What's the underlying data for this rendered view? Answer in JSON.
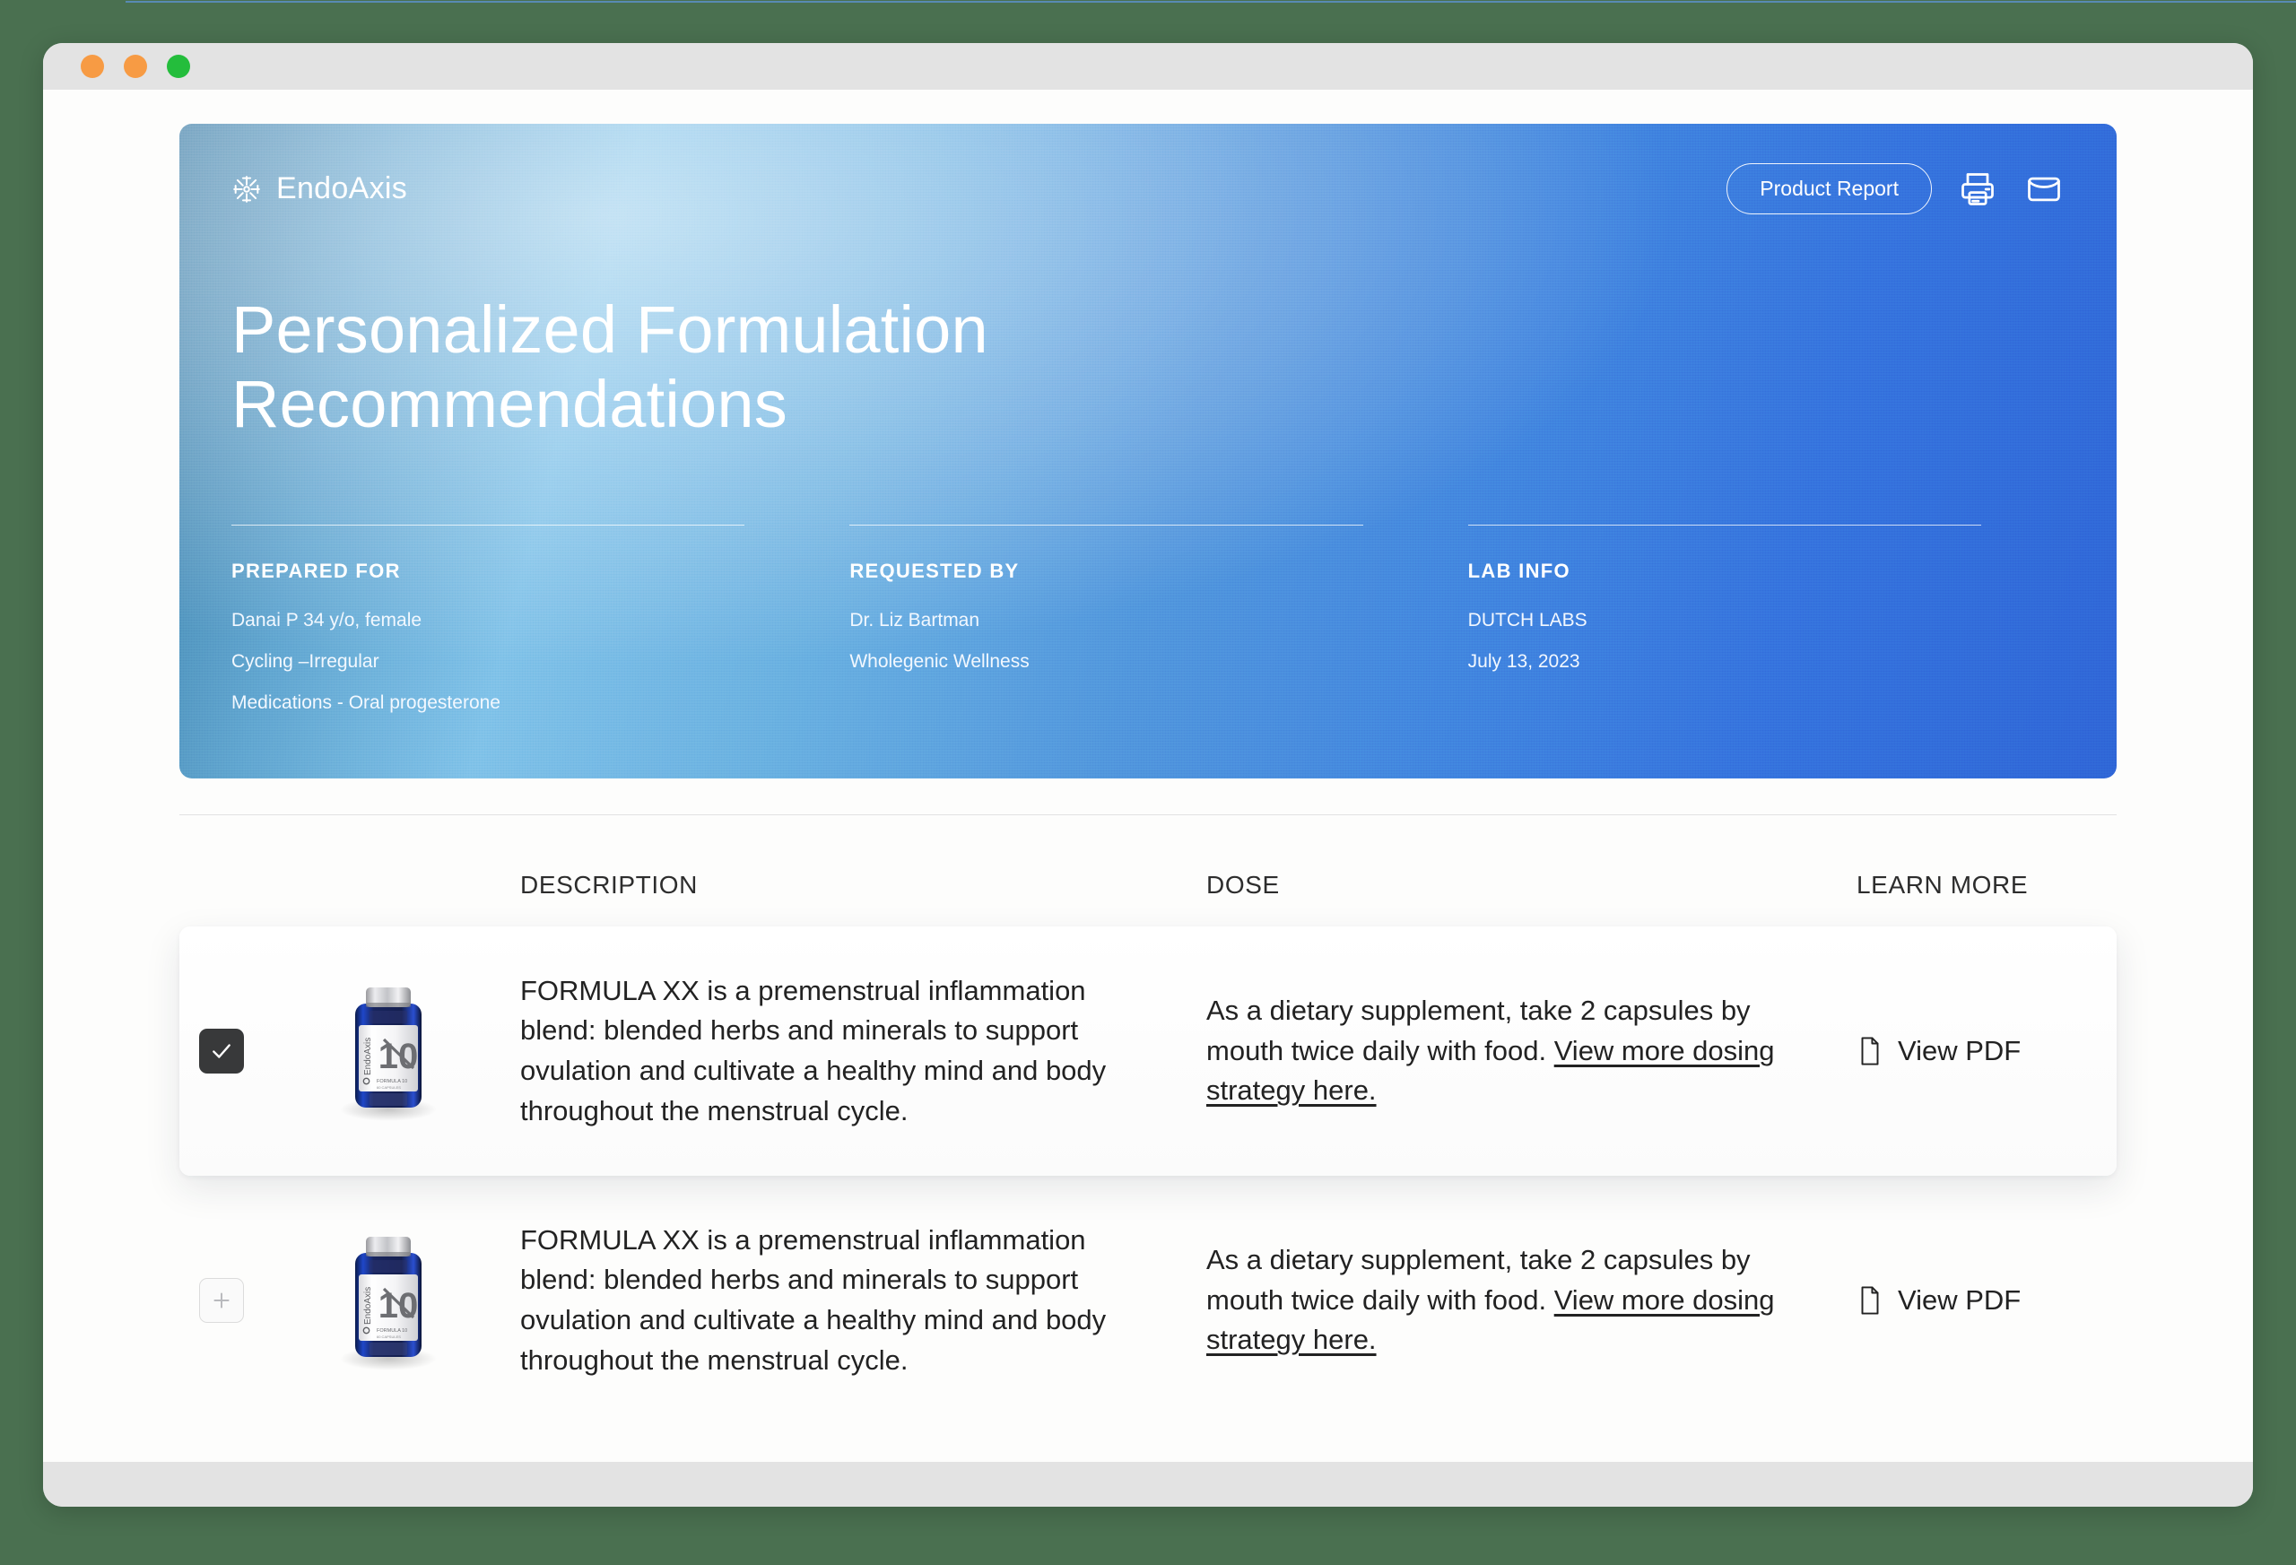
{
  "window": {
    "traffic_lights": [
      "orange",
      "orange",
      "green"
    ]
  },
  "hero": {
    "brand": {
      "name": "EndoAxis",
      "mark_icon": "snowflake-asterisk-icon"
    },
    "actions": {
      "product_report_label": "Product Report",
      "print_icon": "printer-icon",
      "mail_icon": "envelope-icon"
    },
    "title": "Personalized Formulation Recommendations",
    "meta": [
      {
        "heading": "PREPARED FOR",
        "lines": [
          "Danai P    34 y/o, female",
          "Cycling –Irregular",
          "Medications - Oral progesterone"
        ]
      },
      {
        "heading": "REQUESTED BY",
        "lines": [
          "Dr. Liz Bartman",
          "Wholegenic Wellness"
        ]
      },
      {
        "heading": "LAB INFO",
        "lines": [
          "DUTCH LABS",
          "July 13, 2023"
        ]
      }
    ],
    "colors": {
      "gradient_left": "#3f7fa8",
      "gradient_mid": "#7cc0e8",
      "gradient_right": "#2e63d6"
    }
  },
  "table": {
    "headers": {
      "description": "DESCRIPTION",
      "dose": "DOSE",
      "learn_more": "LEARN MORE"
    },
    "rows": [
      {
        "selected": true,
        "checkbox_icon": "check-icon",
        "product_image": {
          "alt": "supplement-bottle",
          "label_number": "10",
          "label_brand": "EndoAxis",
          "label_sub": "FORMULA 10",
          "label_fine": "60 CAPSULES / DIETARY SUPPLEMENT"
        },
        "description": "FORMULA XX is a premenstrual inflammation blend: blended herbs and minerals to support ovulation and cultivate a healthy mind and body throughout the menstrual cycle.",
        "dose_text": "As a dietary supplement, take 2 capsules by mouth twice daily with food. ",
        "dose_link": "View more dosing strategy here.",
        "learn_more_label": "View PDF",
        "learn_more_icon": "file-icon"
      },
      {
        "selected": false,
        "checkbox_icon": "plus-icon",
        "product_image": {
          "alt": "supplement-bottle",
          "label_number": "10",
          "label_brand": "EndoAxis",
          "label_sub": "FORMULA 10",
          "label_fine": "60 CAPSULES / DIETARY SUPPLEMENT"
        },
        "description": "FORMULA XX is a premenstrual inflammation blend: blended herbs and minerals to support ovulation and cultivate a healthy mind and body throughout the menstrual cycle.",
        "dose_text": "As a dietary supplement, take 2 capsules by mouth twice daily with food. ",
        "dose_link": "View more dosing strategy here.",
        "learn_more_label": "View PDF",
        "learn_more_icon": "file-icon"
      }
    ]
  }
}
